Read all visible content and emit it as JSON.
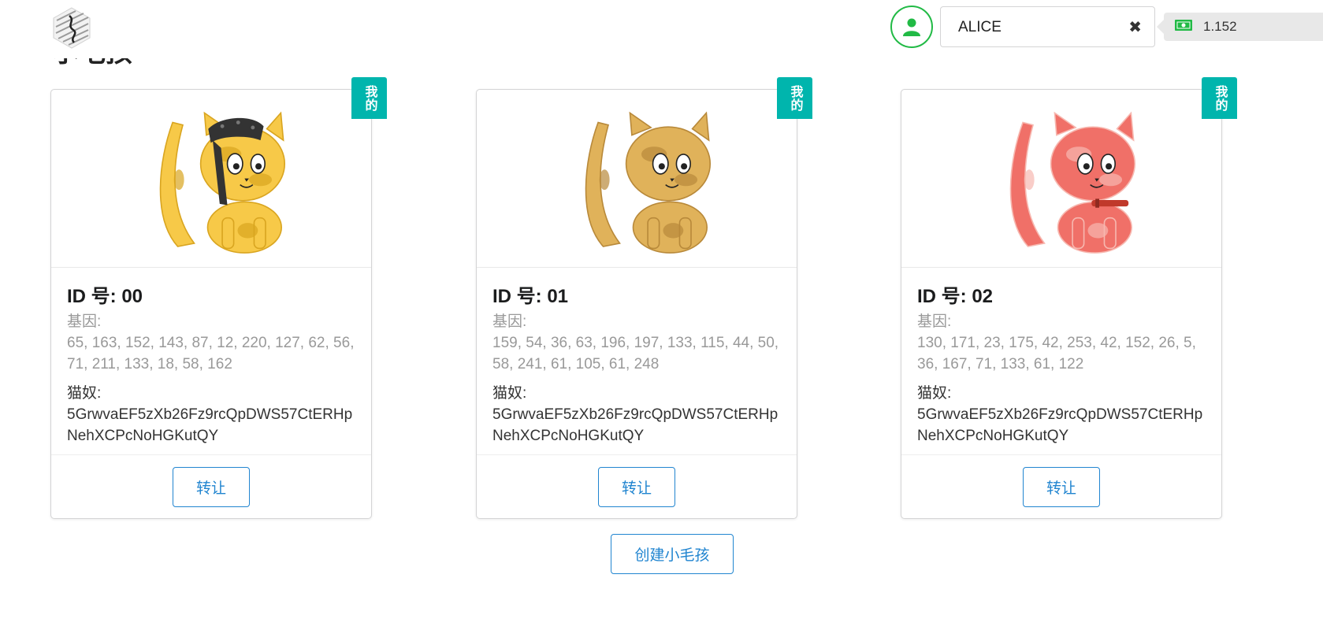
{
  "header": {
    "logo_icon": "substrate-logo-icon",
    "section_title": "小毛孩",
    "account": {
      "name": "ALICE",
      "clear_icon": "✖"
    },
    "balance": {
      "icon": "money-icon",
      "value": "1.152"
    }
  },
  "colors": {
    "accent": "#00b5ad",
    "primary": "#2185d0",
    "positive": "#21ba45"
  },
  "kitties": [
    {
      "ribbon": "我的",
      "id_label": "ID 号: 00",
      "gene_label": "基因:",
      "genes": "65, 163, 152, 143, 87, 12, 220, 127, 62, 56, 71, 211, 133, 18, 58, 162",
      "owner_label": "猫奴:",
      "owner": "5GrwvaEF5zXb26Fz9rcQpDWS57CtERHpNehXCPcNoHGKutQY",
      "transfer_label": "转让",
      "body_color": "#f7c948",
      "spot_color": "#d9a520",
      "accessory": "bandana"
    },
    {
      "ribbon": "我的",
      "id_label": "ID 号: 01",
      "gene_label": "基因:",
      "genes": "159, 54, 36, 63, 196, 197, 133, 115, 44, 50, 58, 241, 61, 105, 61, 248",
      "owner_label": "猫奴:",
      "owner": "5GrwvaEF5zXb26Fz9rcQpDWS57CtERHpNehXCPcNoHGKutQY",
      "transfer_label": "转让",
      "body_color": "#e0b25a",
      "spot_color": "#b8893a",
      "accessory": "none"
    },
    {
      "ribbon": "我的",
      "id_label": "ID 号: 02",
      "gene_label": "基因:",
      "genes": "130, 171, 23, 175, 42, 253, 42, 152, 26, 5, 36, 167, 71, 133, 61, 122",
      "owner_label": "猫奴:",
      "owner": "5GrwvaEF5zXb26Fz9rcQpDWS57CtERHpNehXCPcNoHGKutQY",
      "transfer_label": "转让",
      "body_color": "#f07068",
      "spot_color": "#f7b8b0",
      "accessory": "collar"
    }
  ],
  "create_button_label": "创建小毛孩"
}
